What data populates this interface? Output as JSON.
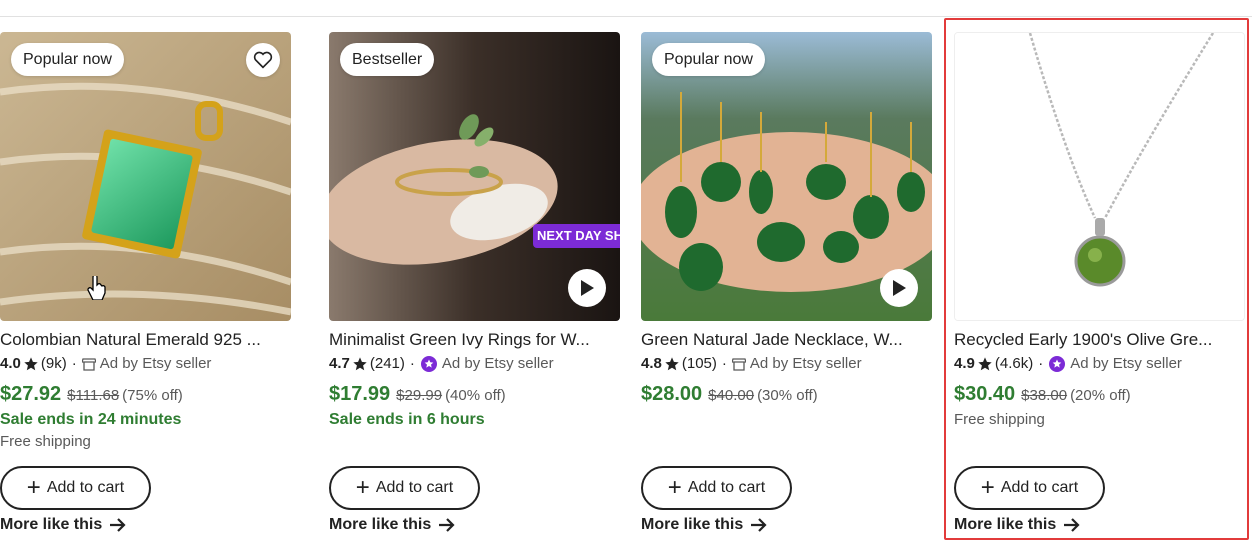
{
  "colors": {
    "price_green": "#2f7d32",
    "highlight": "#e23b3b",
    "star_seller_purple": "#7c2bd6"
  },
  "products": [
    {
      "badge": "Bestseller",
      "title": "Minimalist Green Ivy Rings for W...",
      "rating": "4.7",
      "count": "(241)",
      "seller_icon": "star-seller-badge-icon",
      "ad_text": "Ad by Etsy seller",
      "price": "$17.99",
      "original_price": "$29.99",
      "discount": "(40% off)",
      "sale_text": "Sale ends in 6 hours",
      "banner": "NEXT DAY SHIPP",
      "cart_label": "Add to cart",
      "more_label": "More like this"
    },
    {
      "badge": "Popular now",
      "title": "Green Natural Jade Necklace, W...",
      "rating": "4.8",
      "count": "(105)",
      "seller_icon": "shop-icon",
      "ad_text": "Ad by Etsy seller",
      "price": "$28.00",
      "original_price": "$40.00",
      "discount": "(30% off)",
      "cart_label": "Add to cart",
      "more_label": "More like this"
    },
    {
      "title": "Recycled Early 1900's Olive Gre...",
      "rating": "4.9",
      "count": "(4.6k)",
      "seller_icon": "star-seller-badge-icon",
      "ad_text": "Ad by Etsy seller",
      "price": "$30.40",
      "original_price": "$38.00",
      "discount": "(20% off)",
      "shipping": "Free shipping",
      "cart_label": "Add to cart",
      "more_label": "More like this"
    },
    {
      "badge": "Popular now",
      "title": "Colombian Natural Emerald 925 ...",
      "rating": "4.0",
      "count": "(9k)",
      "seller_icon": "shop-icon",
      "ad_text": "Ad by Etsy seller",
      "price": "$27.92",
      "original_price": "$111.68",
      "discount": "(75% off)",
      "sale_text": "Sale ends in 24 minutes",
      "shipping": "Free shipping",
      "cart_label": "Add to cart",
      "more_label": "More like this"
    }
  ]
}
